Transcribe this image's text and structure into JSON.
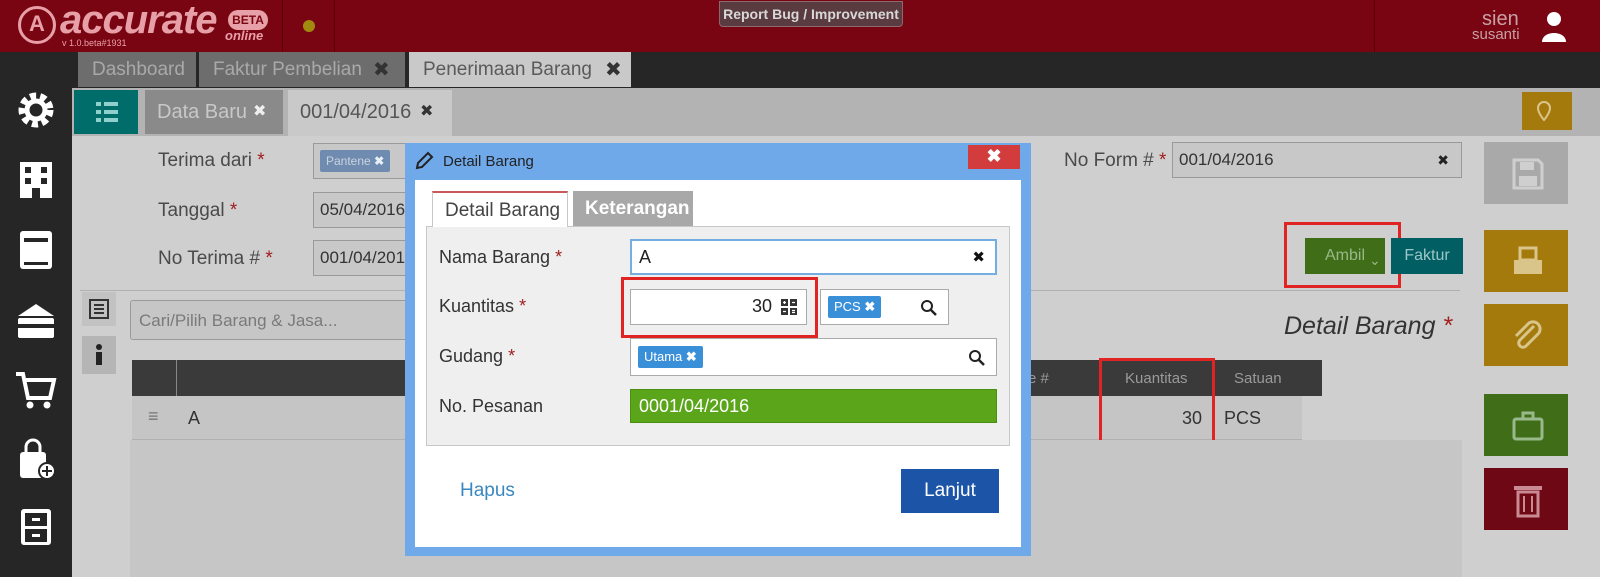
{
  "brand": {
    "logo_letter": "A",
    "name": "accurate",
    "badge": "BETA",
    "edition": "online",
    "version": "v 1.0.beta#1931"
  },
  "header": {
    "report_button": "Report Bug / Improvement",
    "user_name": "sien",
    "user_sub": "susanti"
  },
  "tabs": [
    {
      "label": "Dashboard",
      "close": ""
    },
    {
      "label": "Faktur Pembelian",
      "close": "✖"
    },
    {
      "label": "Penerimaan Barang",
      "close": "✖"
    }
  ],
  "subtabs": [
    {
      "label": "Data Baru",
      "close": "✖"
    },
    {
      "label": "001/04/2016",
      "close": "✖"
    }
  ],
  "form": {
    "terima_dari_label": "Terima dari",
    "terima_dari_tag": "Pantene",
    "tanggal_label": "Tanggal",
    "tanggal_value": "05/04/2016",
    "no_terima_label": "No Terima #",
    "no_terima_value": "001/04/2016",
    "no_form_label": "No Form #",
    "no_form_value": "001/04/2016",
    "required_mark": "*",
    "clear_glyph": "✖"
  },
  "actions": {
    "ambil": "Ambil",
    "ambil_caret": "⌄",
    "faktur": "Faktur"
  },
  "detail": {
    "search_placeholder": "Cari/Pilih Barang & Jasa...",
    "section_title": "Detail Barang",
    "required_mark": "*",
    "columns_partial": "e #",
    "col_kuantitas": "Kuantitas",
    "col_satuan": "Satuan",
    "row_handle": "≡",
    "row_name": "A",
    "row_qty": "30",
    "row_unit": "PCS"
  },
  "modal": {
    "title": "Detail Barang",
    "close": "✖",
    "tab_detail": "Detail Barang",
    "tab_keterangan": "Keterangan",
    "nama_label": "Nama Barang",
    "nama_value": "A",
    "kuantitas_label": "Kuantitas",
    "kuantitas_value": "30",
    "unit_tag": "PCS",
    "gudang_label": "Gudang",
    "gudang_tag": "Utama",
    "pesanan_label": "No. Pesanan",
    "pesanan_value": "0001/04/2016",
    "required_mark": "*",
    "clear_glyph": "✖",
    "tag_remove": "✖",
    "hapus": "Hapus",
    "lanjut": "Lanjut"
  },
  "colors": {
    "brand_bg": "#7a0512",
    "accent_green": "#5aa51a",
    "primary_blue": "#1c55a8",
    "danger": "#e02424"
  }
}
